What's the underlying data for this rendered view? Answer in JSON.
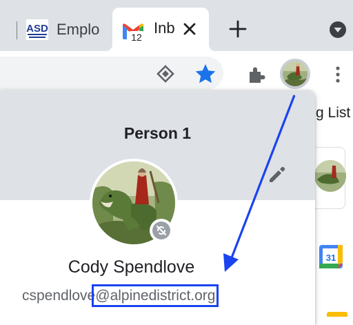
{
  "tabs": [
    {
      "title": "Emplo",
      "favicon": "asd-logo-icon",
      "favicon_text": "ASD"
    },
    {
      "title": "Inb",
      "favicon": "gmail-icon",
      "badge": "12",
      "active": true
    }
  ],
  "toolbar": {
    "icons": [
      "extension-diamond-icon",
      "bookmark-star-icon",
      "extensions-puzzle-icon",
      "profile-avatar-icon",
      "more-menu-icon"
    ]
  },
  "page": {
    "list_label": "g List"
  },
  "calendar_icon": {
    "day": "31"
  },
  "profile_popup": {
    "title": "Person 1",
    "name": "Cody Spendlove",
    "email_user": "cspendlove",
    "email_domain": "@alpinedistrict.org"
  },
  "annotation": {
    "color": "#1a44ef"
  },
  "colors": {
    "chrome_frame": "#dee1e6",
    "star_blue": "#1a73e8",
    "text_dark": "#202124",
    "text_gray": "#5f6368"
  }
}
